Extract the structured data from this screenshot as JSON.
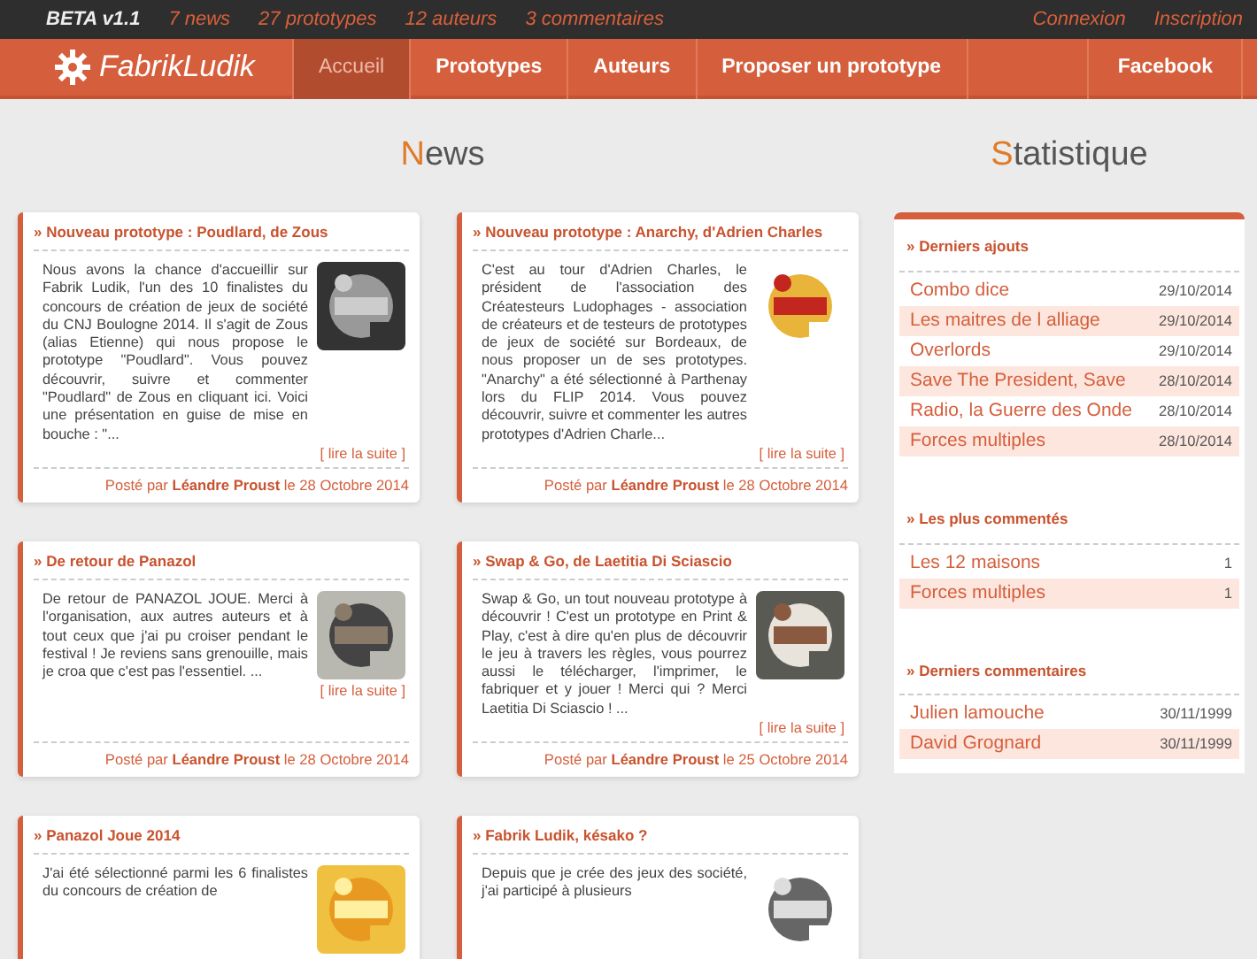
{
  "top_bar": {
    "version": "BETA v1.1",
    "stats": [
      "7 news",
      "27 prototypes",
      "12 auteurs",
      "3 commentaires"
    ],
    "links": [
      "Connexion",
      "Inscription"
    ]
  },
  "nav": {
    "logo": "FabrikLudik",
    "items": [
      {
        "label": "Accueil",
        "selected": true
      },
      {
        "label": "Prototypes",
        "selected": false
      },
      {
        "label": "Auteurs",
        "selected": false
      },
      {
        "label": "Proposer un prototype",
        "selected": false
      }
    ],
    "right_item": "Facebook"
  },
  "news": {
    "heading": "News",
    "articles": [
      {
        "title": "» Nouveau prototype : Poudlard, de Zous",
        "text": "Nous avons la chance d'accueillir sur Fabrik Ludik, l'un des 10 finalistes du concours de création de jeux de société du CNJ Boulogne 2014. Il s'agit de Zous (alias Etienne) qui nous propose le prototype \"Poudlard\". Vous pouvez découvrir, suivre et commenter \"Poudlard\" de Zous en cliquant ici. Voici une présentation en guise de mise en bouche : \"...",
        "more": "[ lire la suite ]",
        "footer": "Posté par **Léandre Proust** le 28 Octobre 2014"
      },
      {
        "title": "» Nouveau prototype : Anarchy, d'Adrien Charles",
        "text": "C'est au tour d'Adrien Charles, le président de l'association des Créatesteurs Ludophages - association de créateurs et de testeurs de prototypes de jeux de société sur Bordeaux, de nous proposer un de ses prototypes. \"Anarchy\" a été sélectionné à Parthenay lors du FLIP 2014. Vous pouvez découvrir, suivre et commenter les autres prototypes d'Adrien Charle...",
        "more": "[ lire la suite ]",
        "footer": "Posté par **Léandre Proust** le 28 Octobre 2014"
      },
      {
        "title": "» De retour de Panazol",
        "text": "De retour de PANAZOL JOUE. Merci à l'organisation, aux autres auteurs et à tout ceux que j'ai pu croiser pendant le festival ! Je reviens sans grenouille, mais je croa que c'est pas l'essentiel. ...",
        "more": "[ lire la suite ]",
        "footer": "Posté par **Léandre Proust** le 28 Octobre 2014"
      },
      {
        "title": "» Swap & Go, de Laetitia Di Sciascio",
        "text": "Swap & Go, un tout nouveau prototype à découvrir ! C'est un prototype en Print & Play, c'est à dire qu'en plus de découvrir le jeu à travers les règles, vous pourrez aussi le télécharger, l'imprimer, le fabriquer et y jouer ! Merci qui ? Merci Laetitia Di Sciascio ! ...",
        "more": "[ lire la suite ]",
        "footer": "Posté par **Léandre Proust** le 25 Octobre 2014"
      },
      {
        "title": "» Panazol Joue 2014",
        "text": "J'ai été sélectionné parmi les 6 finalistes du concours de création de"
      },
      {
        "title": "» Fabrik Ludik, késako ?",
        "text": "Depuis que je crée des jeux des société, j'ai participé à plusieurs"
      }
    ]
  },
  "stats": {
    "heading": "Statistique",
    "sections": [
      {
        "title": "» Derniers ajouts",
        "rows": [
          {
            "name": "Combo dice",
            "value": "29/10/2014"
          },
          {
            "name": "Les maitres de l alliage",
            "value": "29/10/2014"
          },
          {
            "name": "Overlords",
            "value": "29/10/2014"
          },
          {
            "name": "Save The President, Save",
            "value": "28/10/2014"
          },
          {
            "name": "Radio, la Guerre des Onde",
            "value": "28/10/2014"
          },
          {
            "name": "Forces multiples",
            "value": "28/10/2014"
          }
        ]
      },
      {
        "title": "» Les plus commentés",
        "rows": [
          {
            "name": "Les 12 maisons",
            "value": "1"
          },
          {
            "name": "Forces multiples",
            "value": "1"
          }
        ]
      },
      {
        "title": "» Derniers commentaires",
        "rows": [
          {
            "name": "Julien lamouche",
            "value": "30/11/1999"
          },
          {
            "name": "David Grognard",
            "value": "30/11/1999"
          }
        ]
      }
    ]
  }
}
